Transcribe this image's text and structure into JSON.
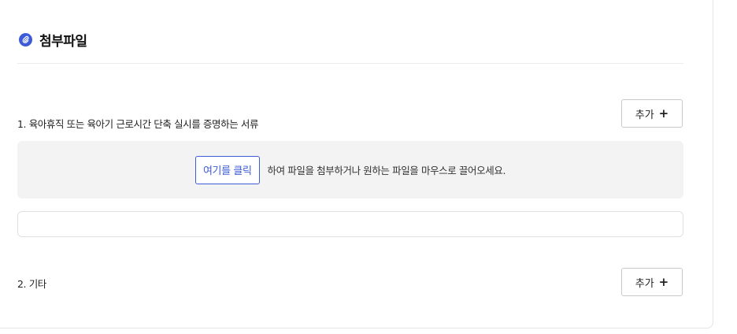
{
  "section": {
    "title": "첨부파일",
    "icon": "paperclip-icon",
    "accent": "#3d5bd9"
  },
  "items": [
    {
      "label": "1. 육아휴직 또는 육아기 근로시간 단축 실시를 증명하는 서류",
      "add_label": "추가"
    },
    {
      "label": "2. 기타",
      "add_label": "추가"
    }
  ],
  "dropzone": {
    "button_label": "여기를 클릭",
    "text": "하여 파일을 첨부하거나 원하는 파일을 마우스로 끌어오세요."
  }
}
